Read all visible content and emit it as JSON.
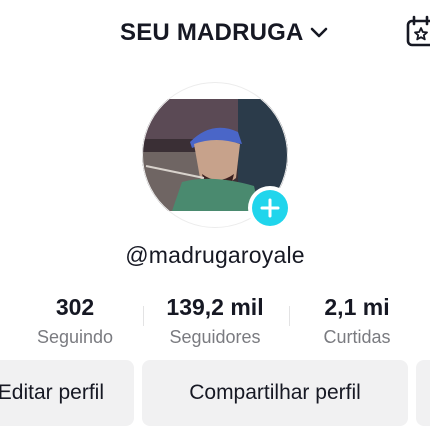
{
  "header": {
    "account_name": "SEU MADRUGA",
    "chevron_icon": "chevron-down-icon",
    "calendar_icon": "calendar-icon"
  },
  "profile": {
    "avatar_icon": "avatar",
    "add_icon": "plus-icon",
    "username": "@madrugaroyale"
  },
  "stats": {
    "following": {
      "value": "302",
      "label": "Seguindo"
    },
    "followers": {
      "value": "139,2 mil",
      "label": "Seguidores"
    },
    "likes": {
      "value": "2,1 mi",
      "label": "Curtidas"
    }
  },
  "actions": {
    "edit_label": "Editar perfil",
    "share_label": "Compartilhar perfil"
  },
  "colors": {
    "accent": "#20d5ec",
    "text": "#161823",
    "muted": "#7a7b80",
    "button_bg": "#f1f1f2"
  }
}
